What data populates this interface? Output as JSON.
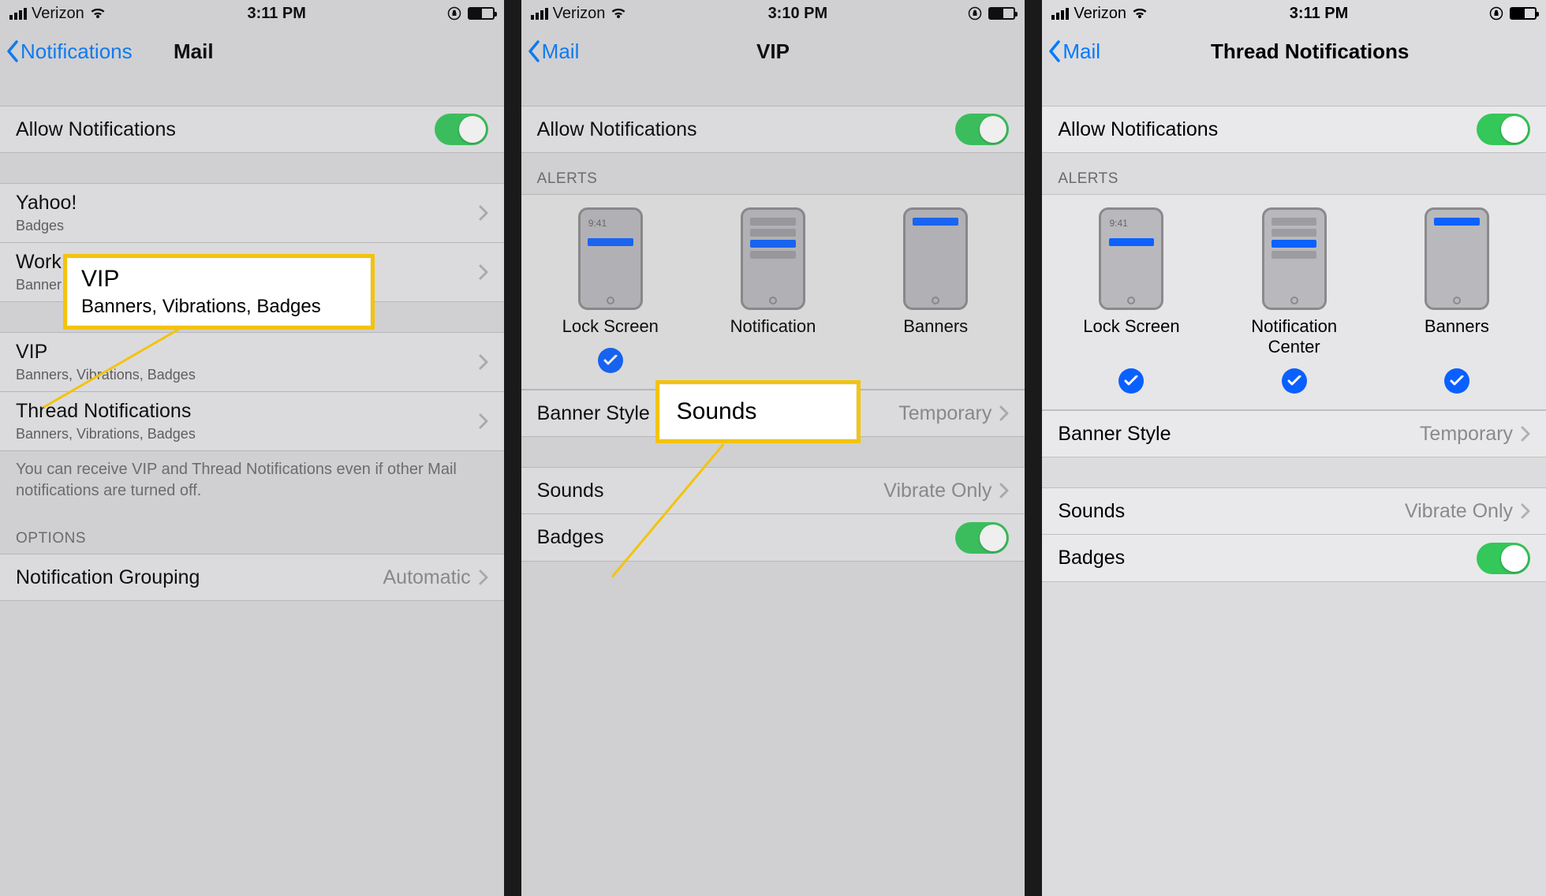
{
  "status": {
    "carrier": "Verizon",
    "time1": "3:11 PM",
    "time2": "3:10 PM",
    "time3": "3:11 PM"
  },
  "screen1": {
    "back": "Notifications",
    "title": "Mail",
    "allow": "Allow Notifications",
    "accounts": [
      {
        "name": "Yahoo!",
        "sub": "Badges"
      },
      {
        "name": "Work",
        "sub": "Banner"
      }
    ],
    "vip": {
      "name": "VIP",
      "sub": "Banners, Vibrations, Badges"
    },
    "thread": {
      "name": "Thread Notifications",
      "sub": "Banners, Vibrations, Badges"
    },
    "footer": "You can receive VIP and Thread Notifications even if other Mail notifications are turned off.",
    "options_header": "OPTIONS",
    "grouping": {
      "label": "Notification Grouping",
      "value": "Automatic"
    },
    "callout": {
      "title": "VIP",
      "sub": "Banners, Vibrations, Badges"
    }
  },
  "screen2": {
    "back": "Mail",
    "title": "VIP",
    "allow": "Allow Notifications",
    "alerts_header": "ALERTS",
    "alerts": {
      "lock": "Lock Screen",
      "center": "Notification",
      "banners": "Banners"
    },
    "mock_time": "9:41",
    "banner_style": {
      "label": "Banner Style",
      "value": "Temporary"
    },
    "sounds": {
      "label": "Sounds",
      "value": "Vibrate Only"
    },
    "badges": "Badges",
    "callout": {
      "title": "Sounds"
    }
  },
  "screen3": {
    "back": "Mail",
    "title": "Thread Notifications",
    "allow": "Allow Notifications",
    "alerts_header": "ALERTS",
    "alerts": {
      "lock": "Lock Screen",
      "center": "Notification Center",
      "banners": "Banners"
    },
    "mock_time": "9:41",
    "banner_style": {
      "label": "Banner Style",
      "value": "Temporary"
    },
    "sounds": {
      "label": "Sounds",
      "value": "Vibrate Only"
    },
    "badges": "Badges"
  }
}
